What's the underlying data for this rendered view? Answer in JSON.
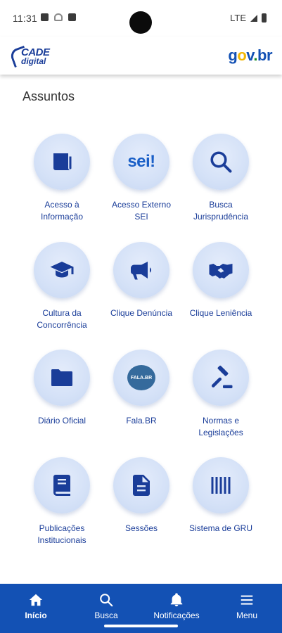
{
  "status_bar": {
    "time": "11:31",
    "network": "LTE"
  },
  "header": {
    "left_logo_text": "CADE",
    "left_logo_sub": "digital",
    "right_logo_parts": [
      "g",
      "o",
      "v",
      ".",
      "br"
    ]
  },
  "section": {
    "title": "Assuntos"
  },
  "tiles": [
    {
      "label_lines": [
        "Acesso à",
        "Informação"
      ],
      "icon": "newspaper-icon"
    },
    {
      "label_lines": [
        "Acesso Externo",
        "SEI"
      ],
      "icon": "sei-logo-icon"
    },
    {
      "label_lines": [
        "Busca",
        "Jurisprudência"
      ],
      "icon": "search-icon"
    },
    {
      "label_lines": [
        "Cultura da",
        "Concorrência"
      ],
      "icon": "graduation-cap-icon"
    },
    {
      "label_lines": [
        "Clique Denúncia"
      ],
      "icon": "megaphone-icon"
    },
    {
      "label_lines": [
        "Clique Leniência"
      ],
      "icon": "handshake-icon"
    },
    {
      "label_lines": [
        "Diário Oficial"
      ],
      "icon": "folder-icon"
    },
    {
      "label_lines": [
        "Fala.BR"
      ],
      "icon": "fala-br-logo-icon"
    },
    {
      "label_lines": [
        "Normas e",
        "Legislações"
      ],
      "icon": "gavel-icon"
    },
    {
      "label_lines": [
        "Publicações",
        "Institucionais"
      ],
      "icon": "book-icon"
    },
    {
      "label_lines": [
        "Sessões"
      ],
      "icon": "document-icon"
    },
    {
      "label_lines": [
        "Sistema de GRU"
      ],
      "icon": "barcode-icon"
    }
  ],
  "sei_icon_text": "sei!",
  "fala_icon_text": "FALA.BR",
  "bottom_nav": [
    {
      "label": "Início",
      "icon": "home-icon",
      "active": true
    },
    {
      "label": "Busca",
      "icon": "search-icon",
      "active": false
    },
    {
      "label": "Notificações",
      "icon": "bell-icon",
      "active": false
    },
    {
      "label": "Menu",
      "icon": "menu-icon",
      "active": false
    }
  ],
  "colors": {
    "brand_blue": "#1351b4",
    "label_blue": "#1a3d99",
    "circle_bg": "#d4e1f7"
  }
}
